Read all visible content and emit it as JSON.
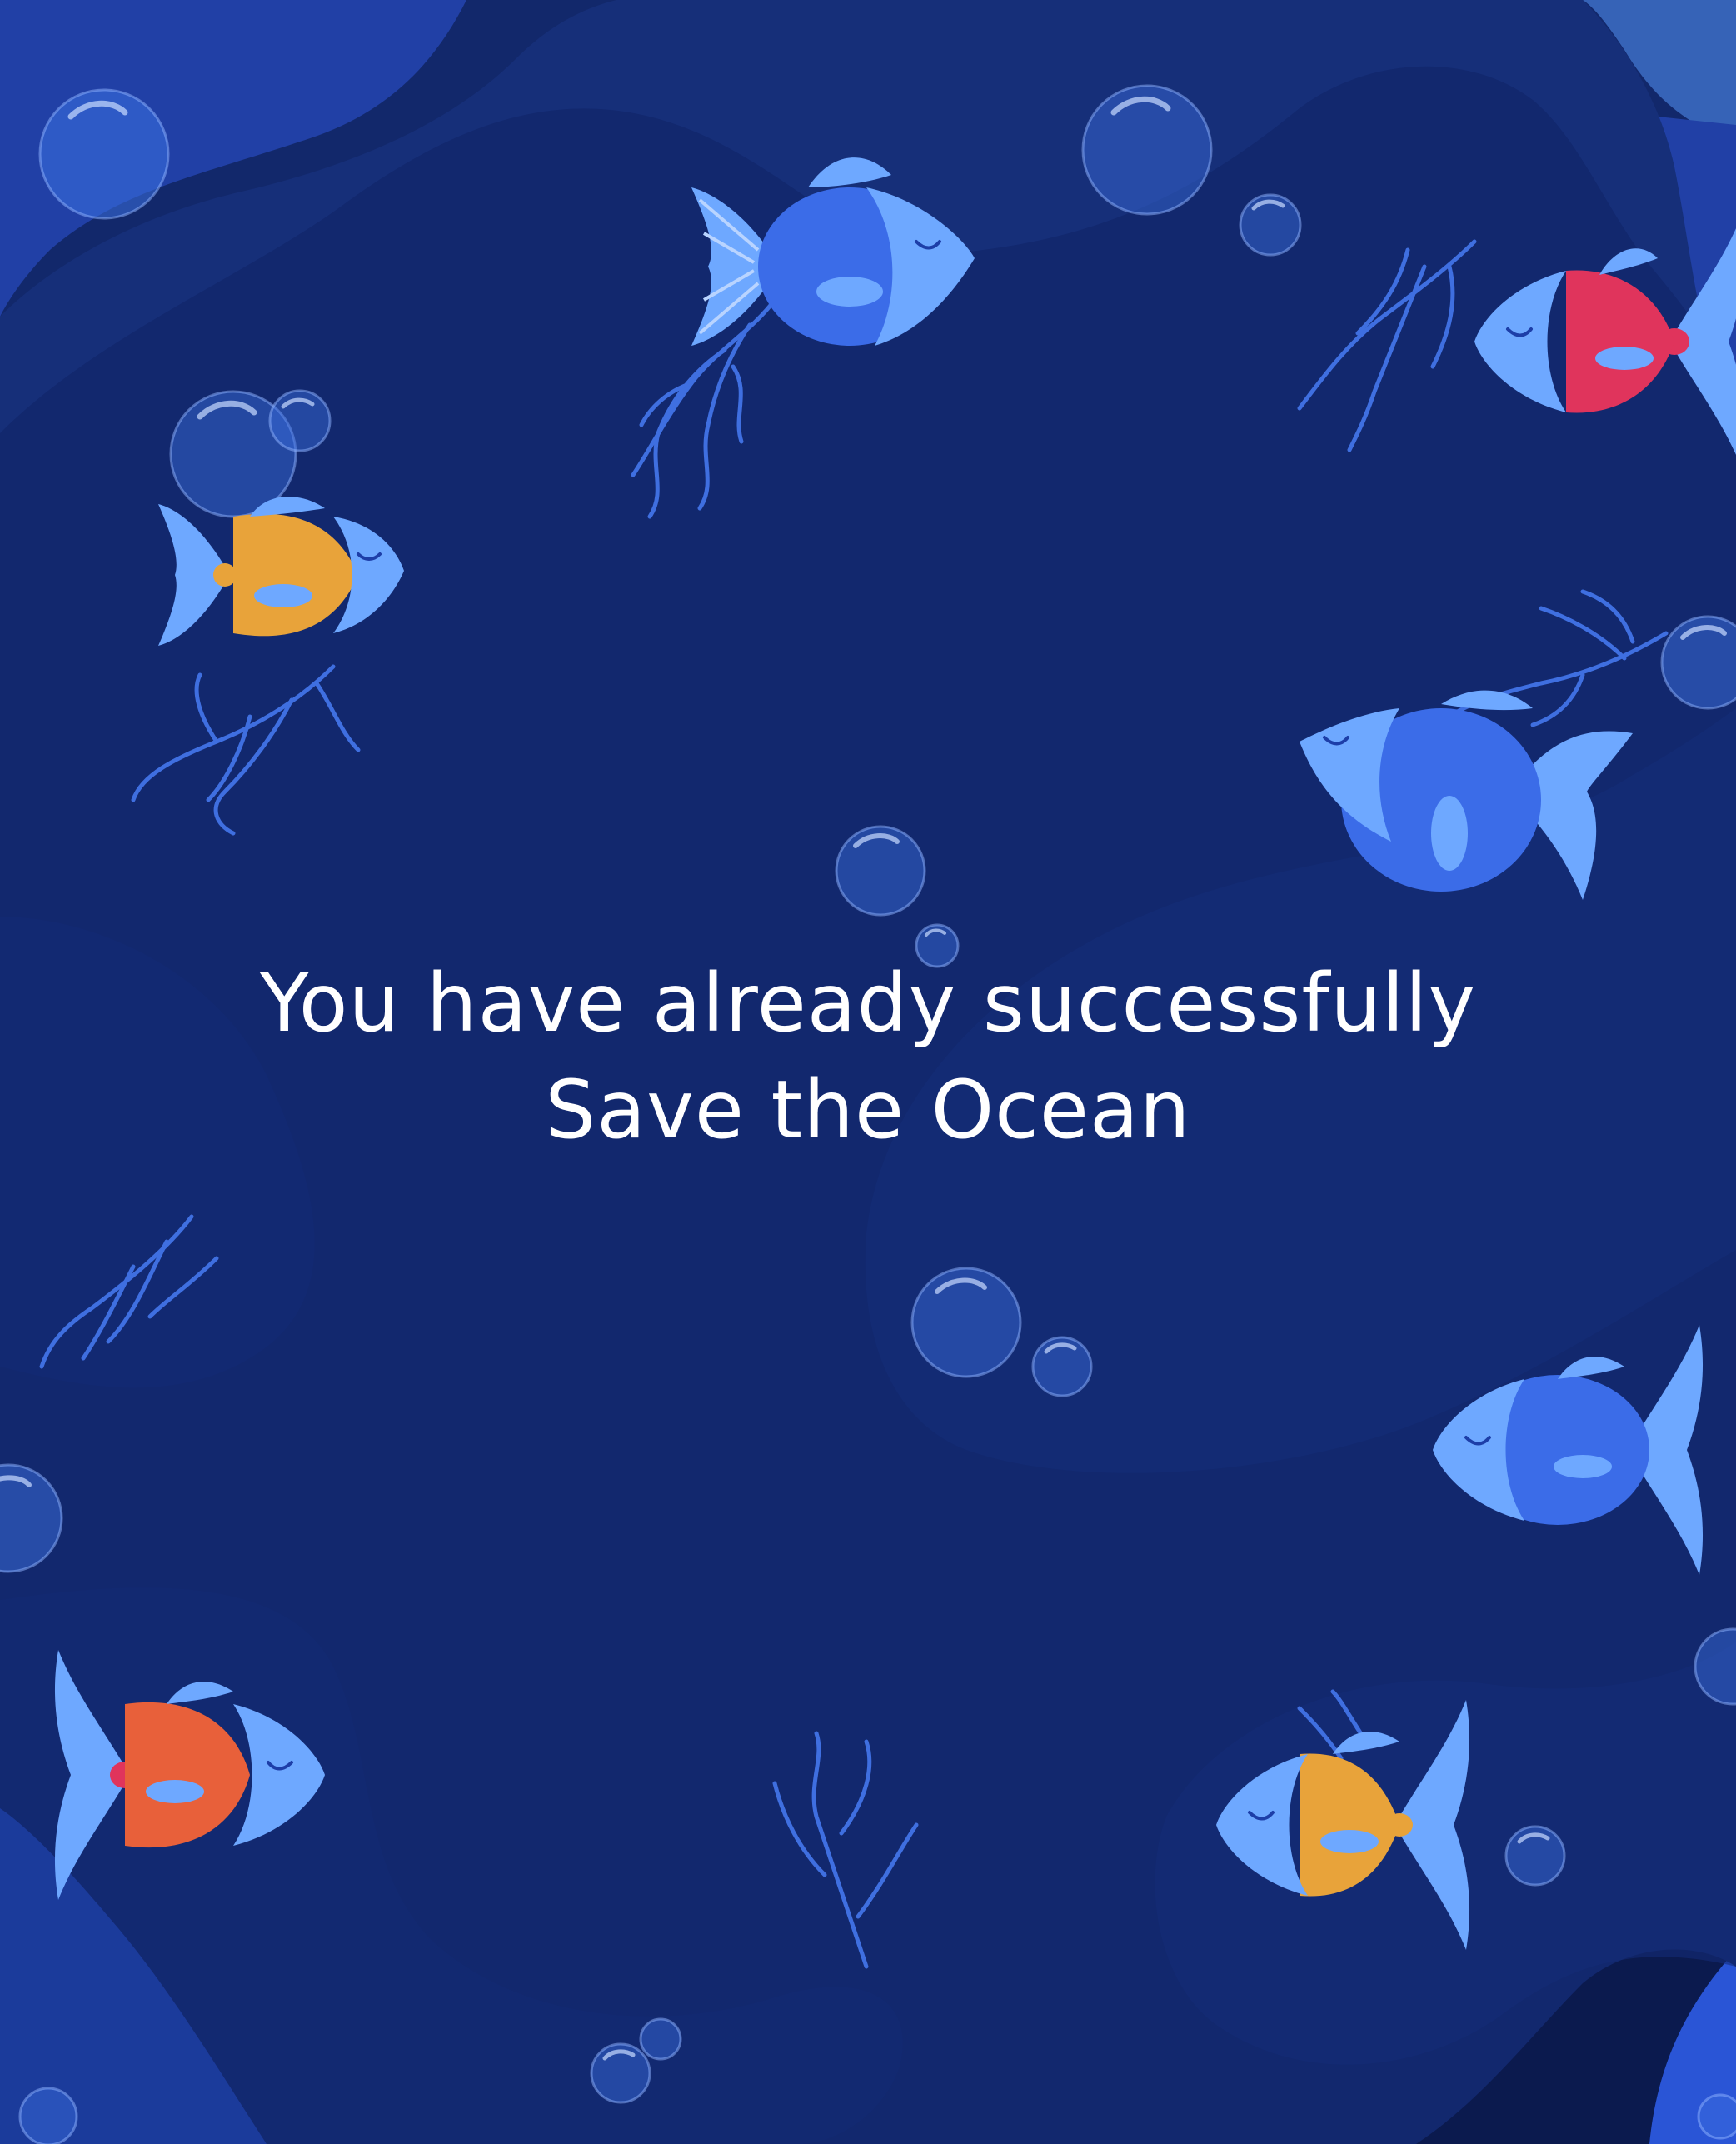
{
  "screen": {
    "message_line1": "You have already successfully",
    "message_line2": "Save the Ocean"
  },
  "palette": {
    "deep_water": "#0b1a4e",
    "mid_water": "#12286e",
    "light_water": "#2a55d6",
    "surface_water": "#5a9cf5",
    "fish_blue": "#3b6ce8",
    "fish_light": "#6ea8ff",
    "fish_orange": "#e8a33a",
    "fish_red": "#e0345c",
    "seaweed": "#3f6fe0",
    "bubble": "#5b8ae0"
  },
  "decorations": {
    "fish": [
      "blue-fish",
      "blue-fish",
      "orange-fish",
      "red-fish",
      "blue-fish",
      "blue-fish",
      "red-fish",
      "orange-fish"
    ],
    "seaweed_count": 7,
    "bubble_count": 20
  }
}
